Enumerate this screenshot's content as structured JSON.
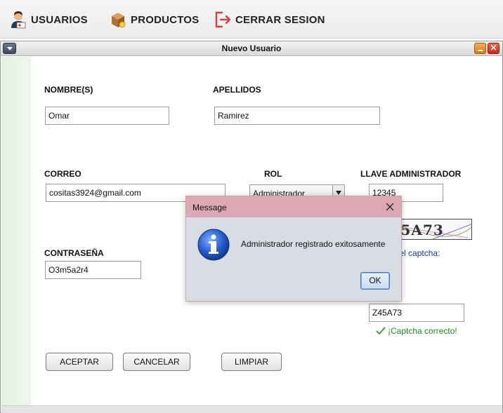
{
  "menubar": {
    "items": [
      {
        "label": "USUARIOS",
        "icon": "user-admin-icon"
      },
      {
        "label": "PRODUCTOS",
        "icon": "box-icon"
      },
      {
        "label": "CERRAR SESION",
        "icon": "logout-icon"
      }
    ]
  },
  "frame": {
    "title": "Nuevo Usuario"
  },
  "form": {
    "nombre_label": "NOMBRE(S)",
    "nombre_value": "Omar",
    "apellidos_label": "APELLIDOS",
    "apellidos_value": "Ramirez",
    "correo_label": "CORREO",
    "correo_value": "cositas3924@gmail.com",
    "rol_label": "ROL",
    "rol_value": "Administrador",
    "llave_label": "LLAVE ADMINISTRADOR",
    "llave_value": "12345",
    "contrasena_label": "CONTRASEÑA",
    "contrasena_value": "O3m5a2r4",
    "captcha_image_text": "Z45A73",
    "captcha_hint": "Ingresa el captcha:",
    "captcha_value": "Z45A73",
    "captcha_status": "¡Captcha correcto!"
  },
  "buttons": {
    "aceptar": "ACEPTAR",
    "cancelar": "CANCELAR",
    "limpiar": "LIMPIAR"
  },
  "dialog": {
    "title": "Message",
    "message": "Administrador registrado exitosamente",
    "ok_label": "OK",
    "icon": "info-icon"
  },
  "colors": {
    "dialog_title": "#dca8b3",
    "captcha_hint": "#1f2fb3",
    "captcha_ok": "#1f8a1f"
  }
}
